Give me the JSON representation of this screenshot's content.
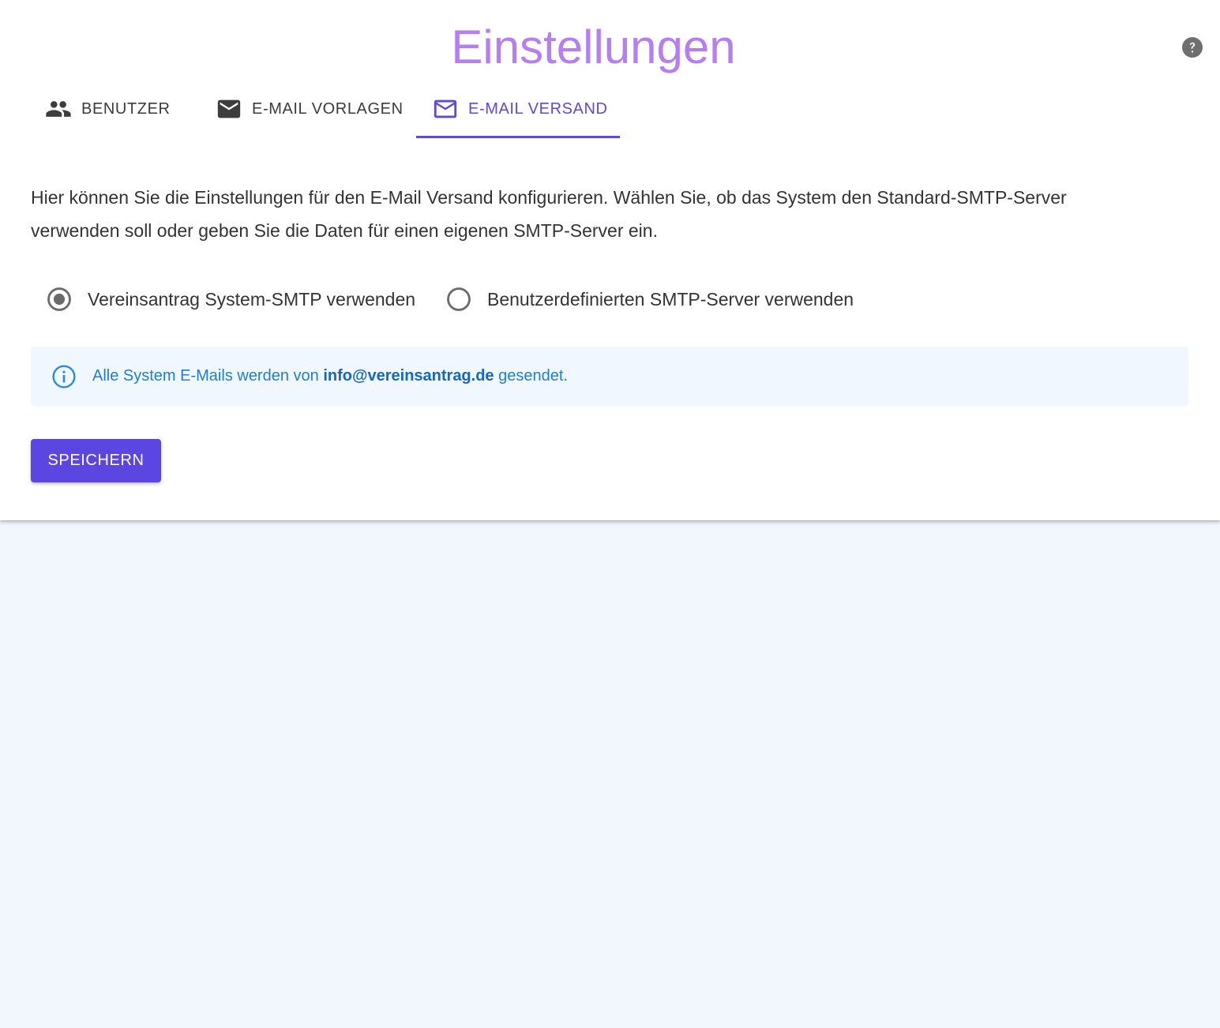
{
  "page": {
    "title": "Einstellungen"
  },
  "header": {
    "help_icon": "help-circle-icon"
  },
  "tabs": [
    {
      "label": "BENUTZER",
      "icon": "people-icon",
      "active": false
    },
    {
      "label": "E-MAIL VORLAGEN",
      "icon": "mail-filled-icon",
      "active": false
    },
    {
      "label": "E-MAIL VERSAND",
      "icon": "mail-outline-icon",
      "active": true
    }
  ],
  "description": "Hier können Sie die Einstellungen für den E-Mail Versand konfigurieren. Wählen Sie, ob das System den Standard-SMTP-Server verwenden soll oder geben Sie die Daten für einen eigenen SMTP-Server ein.",
  "smtp_options": [
    {
      "label": "Vereinsantrag System-SMTP verwenden",
      "selected": true
    },
    {
      "label": "Benutzerdefinierten SMTP-Server verwenden",
      "selected": false
    }
  ],
  "info_alert": {
    "icon": "info-icon",
    "text_before": "Alle System E-Mails werden von ",
    "email": "info@vereinsantrag.de",
    "text_after": " gesendet."
  },
  "actions": {
    "save_label": "SPEICHERN"
  },
  "colors": {
    "accent": "#5e49d8",
    "title": "#b57ff0",
    "info": "#1d7fd4",
    "page_background": "#f2f6fd"
  }
}
